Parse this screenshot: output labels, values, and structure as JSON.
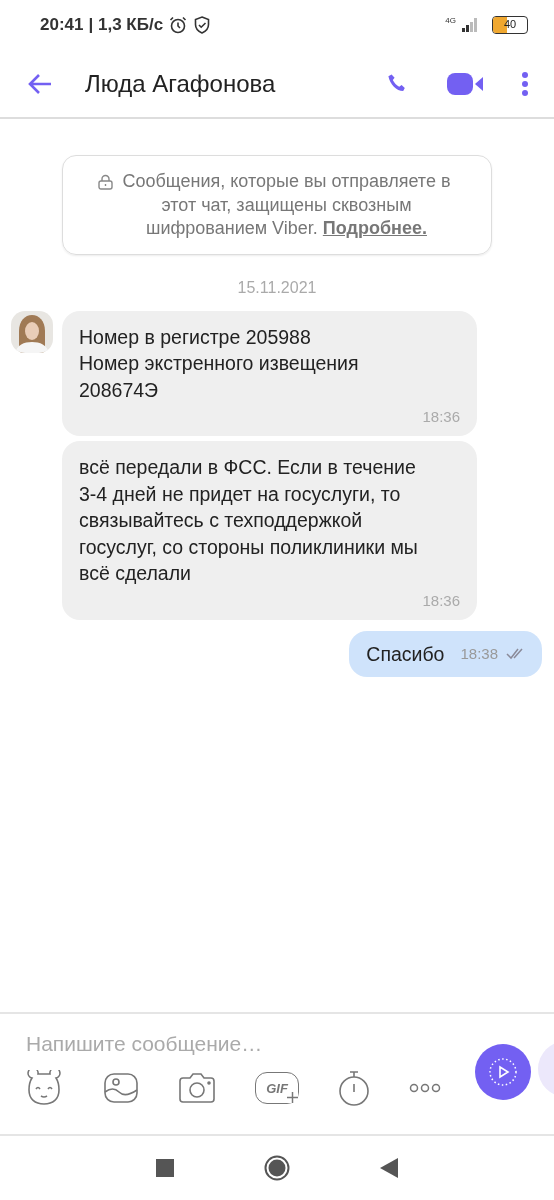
{
  "status_bar": {
    "time": "20:41",
    "speed": "| 1,3 КБ/с",
    "network": "4G",
    "battery": "40"
  },
  "header": {
    "title": "Люда Агафонова"
  },
  "notice": {
    "text": "Сообщения, которые вы отправляете в этот чат, защищены сквозным шифрованием Viber.",
    "link": "Подробнее."
  },
  "date": "15.11.2021",
  "messages": [
    {
      "kind": "incoming",
      "avatar": true,
      "lines": [
        "Номер в регистре 205988",
        "Номер экстренного извещения 208674Э"
      ],
      "time": "18:36"
    },
    {
      "kind": "incoming",
      "avatar": false,
      "lines": [
        "всё передали в ФСС. Если в течение 3-4 дней не придет на госуслуги, то связывайтесь с техподдержкой госуслуг, со стороны поликлиники мы всё сделали"
      ],
      "time": "18:36"
    },
    {
      "kind": "outgoing",
      "lines": [
        "Спасибо"
      ],
      "time": "18:38",
      "read": true
    }
  ],
  "composer": {
    "placeholder": "Напишите сообщение…",
    "gif_label": "GIF"
  }
}
